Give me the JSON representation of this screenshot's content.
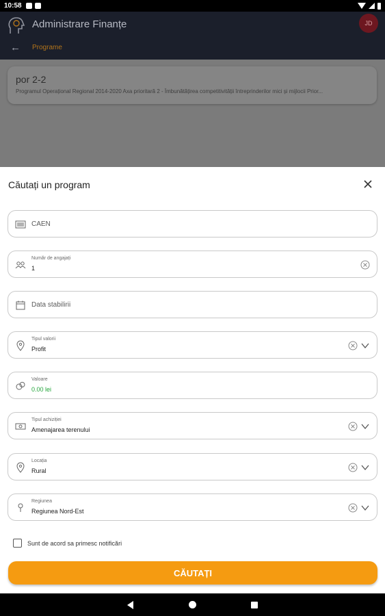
{
  "status_bar": {
    "time": "10:58"
  },
  "app_bar": {
    "title": "Administrare Finanțe",
    "avatar_initials": "JD",
    "breadcrumb": "Programe"
  },
  "content": {
    "card_title": "por 2-2",
    "card_subtitle": "Programul Operațional Regional 2014-2020 Axa prioritară 2 - Îmbunătățirea competitivității întreprinderilor mici și mijlocii Prior..."
  },
  "sheet": {
    "title": "Căutați un program",
    "fields": {
      "caen": {
        "placeholder": "CAEN"
      },
      "employees": {
        "label": "Număr de angajați",
        "value": "1"
      },
      "date": {
        "placeholder": "Data stabilirii"
      },
      "value_type": {
        "label": "Tipul valorii",
        "value": "Profit"
      },
      "value": {
        "label": "Valoare",
        "value": "0.00 lei"
      },
      "acquisition_type": {
        "label": "Tipul achiziției",
        "value": "Amenajarea terenului"
      },
      "location": {
        "label": "Locația",
        "value": "Rural"
      },
      "region": {
        "label": "Regiunea",
        "value": "Regiunea Nord-Est"
      }
    },
    "agree_label": "Sunt de acord sa primesc notificări",
    "search_label": "CĂUTAȚI"
  },
  "colors": {
    "accent": "#f59b11",
    "value_green": "#22a53a",
    "avatar_bg": "#6d1720"
  }
}
